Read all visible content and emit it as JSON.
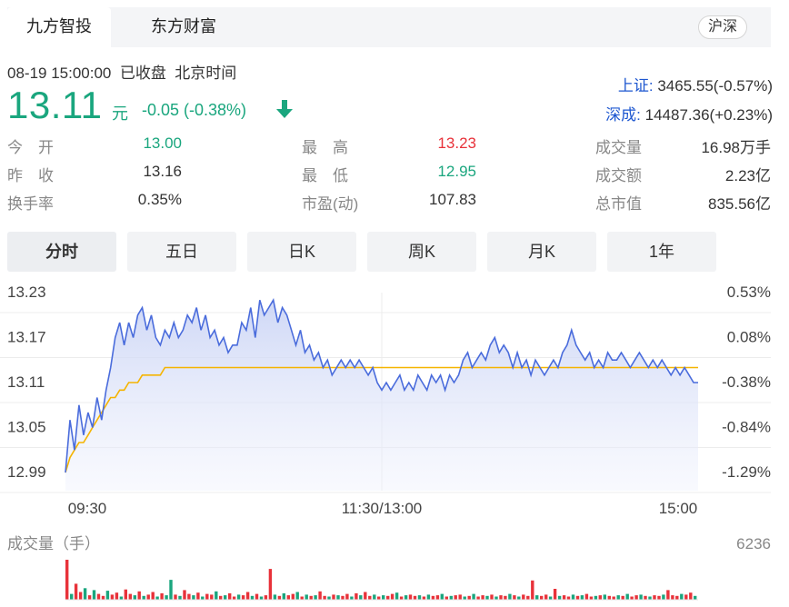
{
  "tabs": {
    "active": "九方智投",
    "other": "东方财富"
  },
  "market_badge": "沪深",
  "quote": {
    "datetime": "08-19 15:00:00",
    "status": "已收盘",
    "timezone": "北京时间",
    "price": "13.11",
    "unit": "元",
    "change": "-0.05 (-0.38%)",
    "direction": "down"
  },
  "indices": [
    {
      "name": "上证:",
      "value": " 3465.55(-0.57%)"
    },
    {
      "name": "深成:",
      "value": " 14487.36(+0.23%)"
    }
  ],
  "stats": {
    "open_label": "今　开",
    "open": "13.00",
    "prev_label": "昨　收",
    "prev": "13.16",
    "turnover_label": "换手率",
    "turnover": "0.35%",
    "high_label": "最　高",
    "high": "13.23",
    "low_label": "最　低",
    "low": "12.95",
    "pe_label": "市盈(动)",
    "pe": "107.83",
    "volume_label": "成交量",
    "volume": "16.98万手",
    "amount_label": "成交额",
    "amount": "2.23亿",
    "mcap_label": "总市值",
    "mcap": "835.56亿"
  },
  "period_tabs": [
    "分时",
    "五日",
    "日K",
    "周K",
    "月K",
    "1年"
  ],
  "active_period": "分时",
  "colors": {
    "up": "#e8323a",
    "down": "#1aa67e",
    "price_line": "#4a6cdc",
    "avg_line": "#f5b400",
    "index_link": "#1e57d0"
  },
  "volume_label": "成交量（手）",
  "volume_max": "6236",
  "chart_data": {
    "type": "line",
    "y_labels_left": [
      "13.23",
      "13.17",
      "13.11",
      "13.05",
      "12.99"
    ],
    "y_labels_right": [
      "0.53%",
      "0.08%",
      "-0.38%",
      "-0.84%",
      "-1.29%"
    ],
    "x_labels": [
      "09:30",
      "11:30/13:00",
      "15:00"
    ],
    "ylim": [
      12.99,
      13.23
    ],
    "series": [
      {
        "values": [
          12.99,
          13.06,
          13.02,
          13.08,
          13.04,
          13.07,
          13.05,
          13.09,
          13.06,
          13.1,
          13.13,
          13.17,
          13.19,
          13.16,
          13.19,
          13.17,
          13.2,
          13.21,
          13.18,
          13.2,
          13.17,
          13.16,
          13.18,
          13.17,
          13.19,
          13.17,
          13.18,
          13.2,
          13.19,
          13.21,
          13.18,
          13.2,
          13.17,
          13.18,
          13.16,
          13.17,
          13.15,
          13.16,
          13.16,
          13.19,
          13.18,
          13.21,
          13.17,
          13.22,
          13.2,
          13.21,
          13.22,
          13.19,
          13.21,
          13.2,
          13.18,
          13.16,
          13.18,
          13.15,
          13.16,
          13.14,
          13.15,
          13.13,
          13.14,
          13.12,
          13.13,
          13.14,
          13.13,
          13.14,
          13.13,
          13.14,
          13.13,
          13.12,
          13.13,
          13.11,
          13.1,
          13.11,
          13.1,
          13.11,
          13.12,
          13.1,
          13.11,
          13.1,
          13.12,
          13.11,
          13.1,
          13.12,
          13.11,
          13.12,
          13.1,
          13.12,
          13.11,
          13.12,
          13.14,
          13.15,
          13.13,
          13.14,
          13.15,
          13.14,
          13.16,
          13.17,
          13.15,
          13.16,
          13.15,
          13.13,
          13.15,
          13.13,
          13.14,
          13.12,
          13.14,
          13.13,
          13.12,
          13.13,
          13.14,
          13.13,
          13.15,
          13.16,
          13.18,
          13.16,
          13.15,
          13.14,
          13.15,
          13.13,
          13.14,
          13.13,
          13.15,
          13.14,
          13.14,
          13.15,
          13.14,
          13.13,
          13.14,
          13.15,
          13.14,
          13.13,
          13.14,
          13.13,
          13.14,
          13.13,
          13.12,
          13.13,
          13.12,
          13.13,
          13.12,
          13.11,
          13.11
        ]
      },
      {
        "values": [
          12.99,
          13.01,
          13.02,
          13.03,
          13.03,
          13.04,
          13.05,
          13.06,
          13.07,
          13.08,
          13.09,
          13.09,
          13.1,
          13.1,
          13.11,
          13.11,
          13.11,
          13.12,
          13.12,
          13.12,
          13.12,
          13.12,
          13.13,
          13.13,
          13.13,
          13.13,
          13.13,
          13.13,
          13.13,
          13.13,
          13.13,
          13.13,
          13.13,
          13.13,
          13.13,
          13.13,
          13.13,
          13.13,
          13.13,
          13.13,
          13.13,
          13.13,
          13.13,
          13.13,
          13.13,
          13.13,
          13.13,
          13.13,
          13.13,
          13.13,
          13.13,
          13.13,
          13.13,
          13.13,
          13.13,
          13.13,
          13.13,
          13.13,
          13.13,
          13.13,
          13.13,
          13.13,
          13.13,
          13.13,
          13.13,
          13.13,
          13.13,
          13.13,
          13.13,
          13.13,
          13.13,
          13.13,
          13.13,
          13.13,
          13.13,
          13.13,
          13.13,
          13.13,
          13.13,
          13.13,
          13.13,
          13.13,
          13.13,
          13.13,
          13.13,
          13.13,
          13.13,
          13.13,
          13.13,
          13.13,
          13.13,
          13.13,
          13.13,
          13.13,
          13.13,
          13.13,
          13.13,
          13.13,
          13.13,
          13.13,
          13.13,
          13.13,
          13.13,
          13.13,
          13.13,
          13.13,
          13.13,
          13.13,
          13.13,
          13.13,
          13.13,
          13.13,
          13.13,
          13.13,
          13.13,
          13.13,
          13.13,
          13.13,
          13.13,
          13.13,
          13.13,
          13.13,
          13.13,
          13.13,
          13.13,
          13.13,
          13.13,
          13.13,
          13.13,
          13.13,
          13.13,
          13.13,
          13.13,
          13.13,
          13.13,
          13.13,
          13.13,
          13.13,
          13.13,
          13.13,
          13.13
        ]
      }
    ],
    "volume": [
      6236,
      900,
      2500,
      1200,
      1800,
      700,
      1500,
      900,
      600,
      1400,
      800,
      1100,
      500,
      1600,
      900,
      700,
      1300,
      600,
      800,
      1200,
      500,
      1000,
      700,
      3100,
      800,
      600,
      1500,
      900,
      700,
      1100,
      500,
      900,
      800,
      1300,
      600,
      700,
      1000,
      500,
      800,
      700,
      1200,
      600,
      900,
      500,
      700,
      4800,
      800,
      600,
      1000,
      700,
      900,
      1200,
      500,
      800,
      600,
      700,
      1300,
      600,
      500,
      800,
      700,
      600,
      900,
      500,
      1000,
      700,
      1200,
      600,
      800,
      500,
      700,
      600,
      900,
      1100,
      500,
      700,
      800,
      600,
      700,
      500,
      800,
      600,
      700,
      900,
      500,
      600,
      700,
      800,
      500,
      600,
      900,
      500,
      700,
      600,
      800,
      500,
      700,
      600,
      900,
      700,
      500,
      800,
      600,
      3000,
      700,
      600,
      800,
      500,
      1700,
      600,
      700,
      500,
      800,
      600,
      700,
      900,
      500,
      600,
      700,
      800,
      600,
      500,
      700,
      600,
      900,
      500,
      700,
      800,
      600,
      500,
      700,
      600,
      800,
      1500,
      700,
      600,
      900,
      800,
      1100,
      600
    ],
    "volume_dir": [
      1,
      -1,
      1,
      1,
      -1,
      1,
      -1,
      1,
      1,
      -1,
      1,
      1,
      -1,
      1,
      1,
      -1,
      1,
      -1,
      1,
      1,
      -1,
      1,
      -1,
      -1,
      1,
      -1,
      1,
      1,
      -1,
      1,
      -1,
      1,
      1,
      -1,
      1,
      -1,
      1,
      1,
      -1,
      1,
      1,
      -1,
      1,
      -1,
      1,
      1,
      -1,
      1,
      -1,
      1,
      1,
      -1,
      1,
      -1,
      1,
      -1,
      1,
      1,
      -1,
      1,
      -1,
      1,
      1,
      -1,
      1,
      -1,
      1,
      1,
      -1,
      1,
      -1,
      1,
      1,
      -1,
      1,
      -1,
      1,
      1,
      -1,
      1,
      -1,
      1,
      1,
      -1,
      1,
      -1,
      1,
      1,
      -1,
      1,
      -1,
      1,
      1,
      -1,
      1,
      -1,
      1,
      1,
      -1,
      1,
      -1,
      1,
      1,
      1,
      -1,
      1,
      1,
      -1,
      1,
      -1,
      1,
      1,
      -1,
      1,
      -1,
      1,
      1,
      -1,
      1,
      -1,
      1,
      1,
      -1,
      1,
      -1,
      1,
      1,
      -1,
      1,
      -1,
      1,
      1,
      -1,
      1,
      1,
      1,
      -1,
      1,
      1,
      -1
    ]
  }
}
